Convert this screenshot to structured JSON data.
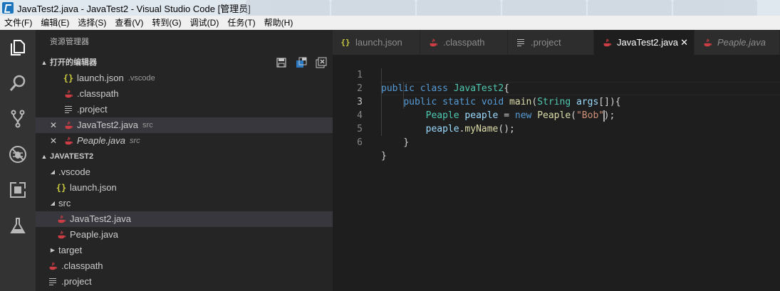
{
  "window": {
    "title": "JavaTest2.java - JavaTest2 - Visual Studio Code [管理员]"
  },
  "menu": [
    "文件(F)",
    "编辑(E)",
    "选择(S)",
    "查看(V)",
    "转到(G)",
    "调试(D)",
    "任务(T)",
    "帮助(H)"
  ],
  "activity_bar": [
    "explorer-icon",
    "search-icon",
    "source-control-icon",
    "debug-icon",
    "extensions-icon",
    "test-flask-icon"
  ],
  "sidebar": {
    "title": "资源管理器",
    "open_editors": {
      "header": "打开的编辑器",
      "items": [
        {
          "label": "launch.json",
          "desc": ".vscode",
          "icon": "json-braces-icon"
        },
        {
          "label": ".classpath",
          "desc": "",
          "icon": "java-icon"
        },
        {
          "label": ".project",
          "desc": "",
          "icon": "lines-icon"
        },
        {
          "label": "JavaTest2.java",
          "desc": "src",
          "icon": "java-icon",
          "active": true
        },
        {
          "label": "Peaple.java",
          "desc": "src",
          "icon": "java-icon",
          "italic": true
        }
      ]
    },
    "project": {
      "header": "JAVATEST2",
      "tree": [
        {
          "label": ".vscode"
        },
        {
          "label": "launch.json"
        },
        {
          "label": "src"
        },
        {
          "label": "JavaTest2.java"
        },
        {
          "label": "Peaple.java"
        },
        {
          "label": "target"
        },
        {
          "label": ".classpath"
        },
        {
          "label": ".project"
        }
      ]
    }
  },
  "tabs": [
    {
      "label": "launch.json",
      "icon": "json-braces-icon"
    },
    {
      "label": ".classpath",
      "icon": "java-icon"
    },
    {
      "label": ".project",
      "icon": "lines-icon"
    },
    {
      "label": "JavaTest2.java",
      "icon": "java-icon",
      "active": true,
      "close": "✕"
    },
    {
      "label": "Peaple.java",
      "icon": "java-icon",
      "italic": true
    }
  ],
  "editor": {
    "line_numbers": [
      "1",
      "2",
      "3",
      "4",
      "5",
      "6"
    ],
    "active_line": "3",
    "code": {
      "l1": [
        "public",
        "class",
        "JavaTest2",
        "{"
      ],
      "l2": [
        "public",
        "static",
        "void",
        "main",
        "(",
        "String",
        "args",
        "[]){"
      ],
      "l3": [
        "Peaple",
        "peaple",
        "=",
        "new",
        "Peaple",
        "(",
        "\"Bob\"",
        ");"
      ],
      "l4": [
        "peaple",
        ".",
        "myName",
        "();"
      ],
      "l5": [
        "}"
      ],
      "l6": [
        "}"
      ]
    }
  },
  "colors": {
    "keyword": "#569cd6",
    "type": "#4ec9b0",
    "function": "#dcdcaa",
    "variable": "#9cdcfe",
    "string": "#ce9178",
    "java_icon": "#cc3e44",
    "json_icon": "#cbcb41"
  }
}
